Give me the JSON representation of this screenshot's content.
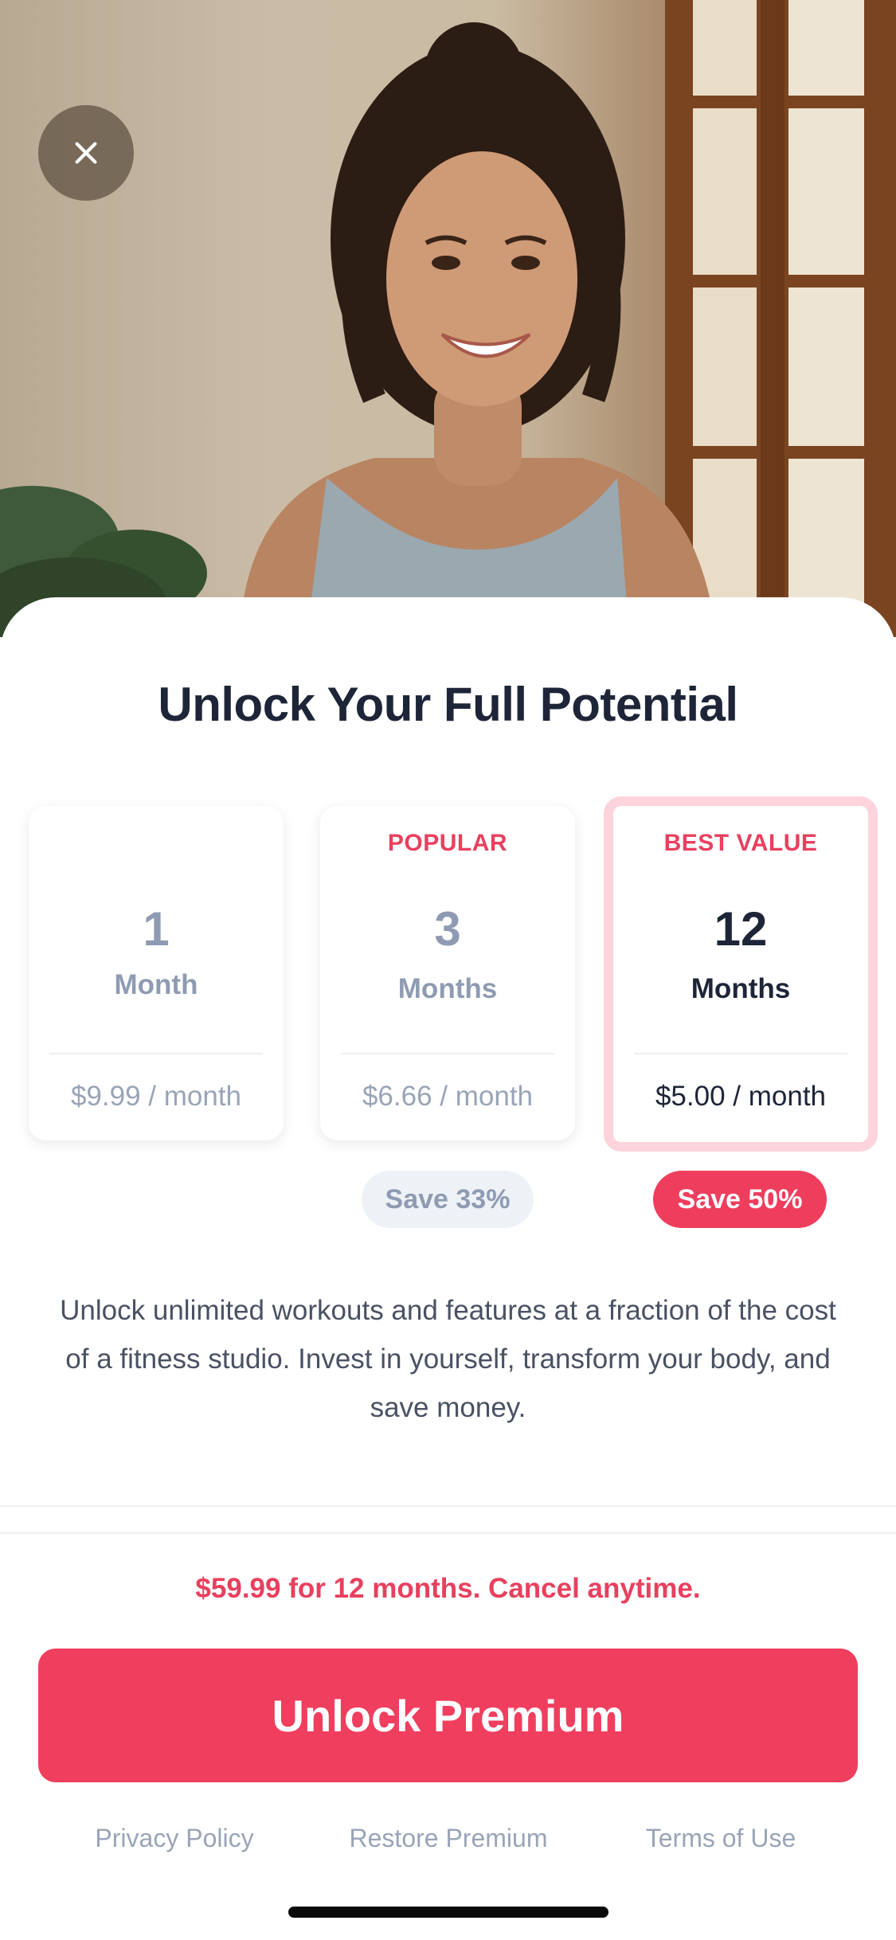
{
  "hero": {
    "image": "smiling-woman-in-tank-top-photo"
  },
  "close_button": {
    "icon": "close-icon"
  },
  "paywall": {
    "title": "Unlock Your Full Potential",
    "plans": [
      {
        "tag": "",
        "number": "1",
        "unit": "Month",
        "price": "$9.99 / month",
        "selected": false
      },
      {
        "tag": "POPULAR",
        "number": "3",
        "unit": "Months",
        "price": "$6.66 / month",
        "selected": false,
        "savings": "Save 33%"
      },
      {
        "tag": "BEST VALUE",
        "number": "12",
        "unit": "Months",
        "price": "$5.00 / month",
        "selected": true,
        "savings": "Save 50%"
      }
    ],
    "description": "Unlock unlimited workouts and features at a fraction of the cost of a fitness studio. Invest in yourself, transform your body, and save money.",
    "summary": "$59.99 for 12 months. Cancel anytime.",
    "cta_label": "Unlock Premium"
  },
  "footer": {
    "privacy": "Privacy Policy",
    "restore": "Restore Premium",
    "terms": "Terms of Use"
  },
  "colors": {
    "accent": "#f03e5f",
    "title": "#1e2538",
    "muted": "#8f9bb3",
    "selected_border": "#fdd3dc"
  }
}
